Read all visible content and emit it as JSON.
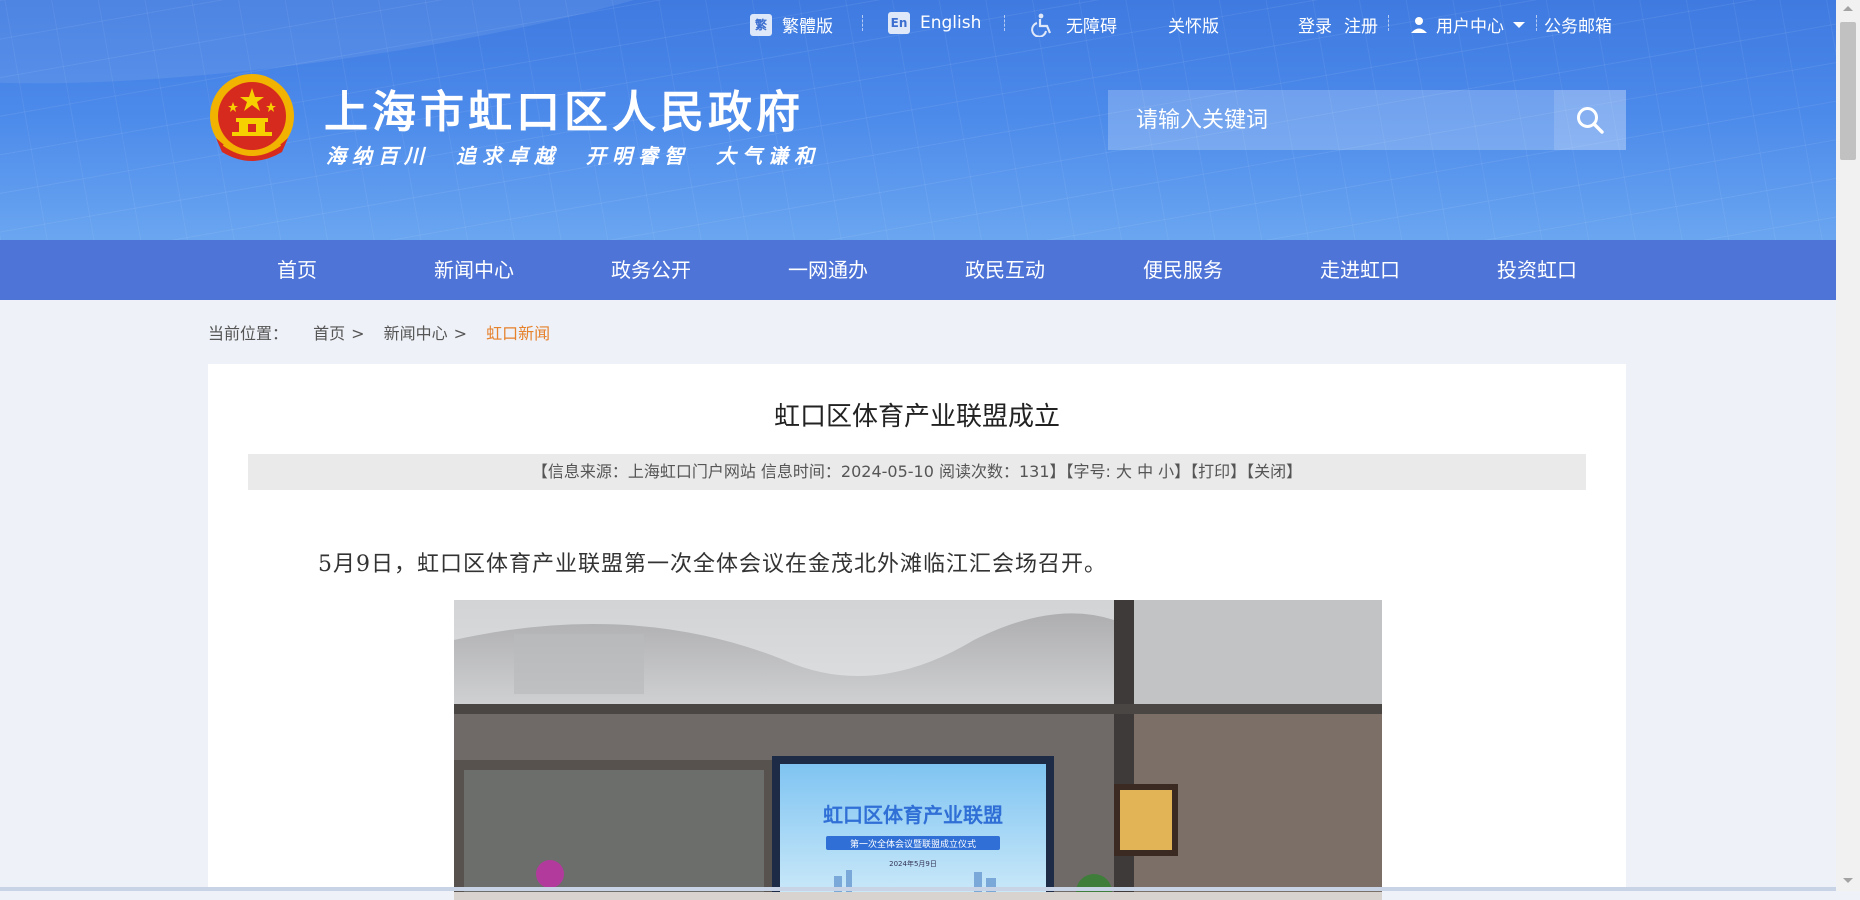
{
  "topbar": {
    "traditional": "繁體版",
    "traditional_icon": "繁",
    "english": "English",
    "english_icon": "En",
    "accessibility": "无障碍",
    "care": "关怀版",
    "login": "登录",
    "register": "注册",
    "user_center": "用户中心",
    "mail": "公务邮箱"
  },
  "site": {
    "title": "上海市虹口区人民政府",
    "motto": "海纳百川　追求卓越　开明睿智　大气谦和"
  },
  "search": {
    "placeholder": "请输入关键词"
  },
  "nav": [
    "首页",
    "新闻中心",
    "政务公开",
    "一网通办",
    "政民互动",
    "便民服务",
    "走进虹口",
    "投资虹口"
  ],
  "breadcrumb": {
    "label": "当前位置：",
    "items": [
      "首页",
      "新闻中心"
    ],
    "current": "虹口新闻"
  },
  "article": {
    "title": "虹口区体育产业联盟成立",
    "meta": "【信息来源：上海虹口门户网站  信息时间：2024-05-10  阅读次数：131】【字号: 大 中 小】【打印】【关闭】",
    "paragraph": "5月9日，虹口区体育产业联盟第一次全体会议在金茂北外滩临江汇会场召开。",
    "photo": {
      "screen_title": "虹口区体育产业联盟",
      "screen_subtitle": "第一次全体会议暨联盟成立仪式",
      "screen_date": "2024年5月9日"
    }
  },
  "colors": {
    "header_blue": "#4b89ea",
    "nav_blue": "#4e74d8",
    "breadcrumb_current": "#e6812c"
  }
}
